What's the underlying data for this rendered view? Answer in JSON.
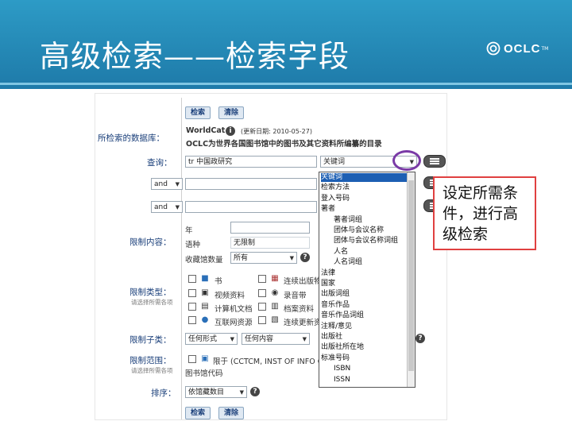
{
  "slide": {
    "title": "高级检索——检索字段",
    "logo_text": "OCLC",
    "logo_tm": "TM",
    "callout_lines": [
      "设定所需条",
      "件，进行高",
      "级检索"
    ]
  },
  "form": {
    "search_button": "检索",
    "clear_button": "清除",
    "db_label": "所检索的数据库：",
    "db_name": "WorldCat",
    "db_updated": "(更新日期: 2010-05-27)",
    "db_desc": "OCLC为世界各国图书馆中的图书及其它资料所编纂的目录",
    "query_label": "查询：",
    "query_rows": [
      {
        "prefix": "tr",
        "value": "中国政研究",
        "field": "关键词"
      },
      {
        "operator": "and",
        "value": ""
      },
      {
        "operator": "and",
        "value": ""
      }
    ],
    "limits_label": "限制内容：",
    "limit_year_label": "年",
    "limit_lang_label": "语种",
    "limit_lang_value": "无限制",
    "limit_holdings_label": "收藏馆数量",
    "limit_holdings_value": "所有",
    "type_label": "限制类型：",
    "type_sub": "请选择所需各项",
    "types_left": [
      "书",
      "视频资料",
      "计算机文档",
      "互联网资源"
    ],
    "types_right": [
      "连续出版物",
      "录音带",
      "档案资料",
      "连续更新资源"
    ],
    "subtype_label": "限制子类：",
    "subtype_values": [
      "任何形式",
      "任何内容"
    ],
    "scope_label": "限制范围：",
    "scope_sub": "请选择所需各项",
    "scope_text": "限于 (CCTCM, INST OF INFO ON...",
    "library_code_label": "图书馆代码",
    "sort_label": "排序：",
    "sort_value": "依馆藏数目",
    "bottom_search_button": "检索",
    "bottom_clear_button": "清除"
  },
  "dropdown": {
    "items": [
      {
        "label": "关键词",
        "indent": 0,
        "selected": true
      },
      {
        "label": "检索方法",
        "indent": 0
      },
      {
        "label": "登入号码",
        "indent": 0
      },
      {
        "label": "著者",
        "indent": 0
      },
      {
        "label": "著者词组",
        "indent": 1
      },
      {
        "label": "团体与会议名称",
        "indent": 1
      },
      {
        "label": "团体与会议名称词组",
        "indent": 1
      },
      {
        "label": "人名",
        "indent": 1
      },
      {
        "label": "人名词组",
        "indent": 1
      },
      {
        "label": "法律",
        "indent": 0
      },
      {
        "label": "国家",
        "indent": 0
      },
      {
        "label": "出版词组",
        "indent": 0
      },
      {
        "label": "音乐作品",
        "indent": 0
      },
      {
        "label": "音乐作品词组",
        "indent": 0
      },
      {
        "label": "注释/意见",
        "indent": 0
      },
      {
        "label": "出版社",
        "indent": 0
      },
      {
        "label": "出版社所在地",
        "indent": 0
      },
      {
        "label": "标准号码",
        "indent": 0
      },
      {
        "label": "ISBN",
        "indent": 1
      },
      {
        "label": "ISSN",
        "indent": 1
      }
    ]
  },
  "colors": {
    "header": "#2487b4",
    "label_blue": "#1a3f7a",
    "callout_border": "#e04040",
    "circle": "#7a3aa6",
    "selected": "#1d5fb3"
  }
}
